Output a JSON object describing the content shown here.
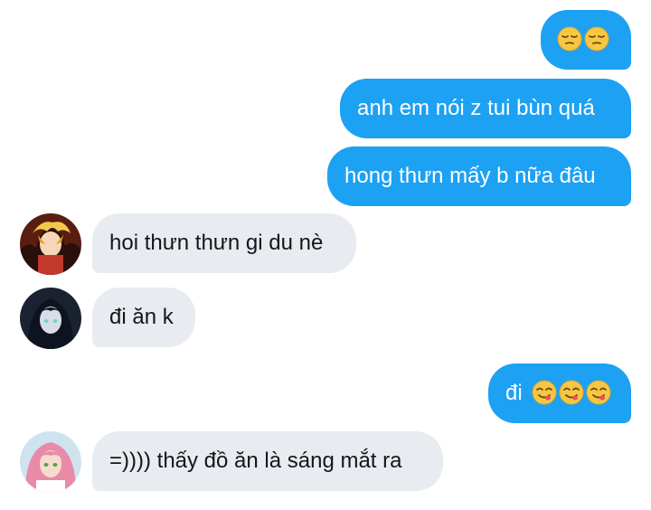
{
  "messages": {
    "m1": {
      "sender": "me",
      "text": "",
      "emoji": [
        "pensive-face",
        "pensive-face"
      ]
    },
    "m2": {
      "sender": "me",
      "text": "anh em nói z tui bùn quá"
    },
    "m3": {
      "sender": "me",
      "text": "hong thưn mấy b nữa đâu"
    },
    "m4": {
      "sender": "friend-1",
      "avatar": "avatar-anime-blonde-flame",
      "text": "hoi thưn thưn gi du nè"
    },
    "m5": {
      "sender": "friend-2",
      "avatar": "avatar-anime-dark-hair",
      "text": "đi ăn k"
    },
    "m6": {
      "sender": "me",
      "text": "đi",
      "emoji": [
        "face-savoring-food",
        "face-savoring-food",
        "face-savoring-food"
      ]
    },
    "m7": {
      "sender": "friend-3",
      "avatar": "avatar-anime-pink-hair",
      "text": "=)))) thấy đồ ăn là sáng mắt ra"
    }
  },
  "colors": {
    "outgoing_bubble": "#1da1f2",
    "incoming_bubble": "#e8ecf0",
    "incoming_text": "#14171a",
    "outgoing_text": "#ffffff"
  }
}
